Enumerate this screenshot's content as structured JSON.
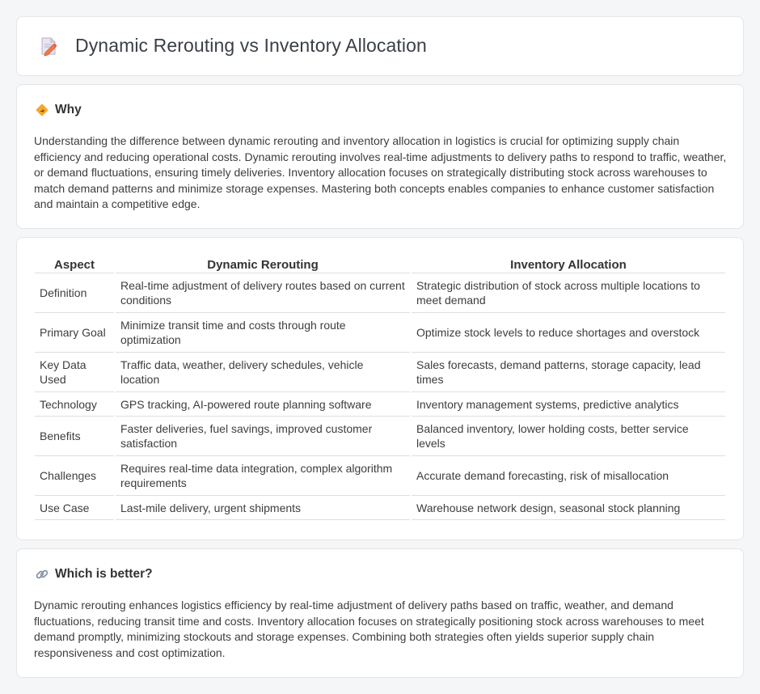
{
  "header": {
    "title": "Dynamic Rerouting vs Inventory Allocation",
    "icon": "document-pencil-icon"
  },
  "why": {
    "title": "Why",
    "icon": "diamond-road-sign-icon",
    "text": "Understanding the difference between dynamic rerouting and inventory allocation in logistics is crucial for optimizing supply chain efficiency and reducing operational costs. Dynamic rerouting involves real-time adjustments to delivery paths to respond to traffic, weather, or demand fluctuations, ensuring timely deliveries. Inventory allocation focuses on strategically distributing stock across warehouses to match demand patterns and minimize storage expenses. Mastering both concepts enables companies to enhance customer satisfaction and maintain a competitive edge."
  },
  "table": {
    "headers": [
      "Aspect",
      "Dynamic Rerouting",
      "Inventory Allocation"
    ],
    "rows": [
      {
        "aspect": "Definition",
        "dynamic": "Real-time adjustment of delivery routes based on current conditions",
        "inventory": "Strategic distribution of stock across multiple locations to meet demand"
      },
      {
        "aspect": "Primary Goal",
        "dynamic": "Minimize transit time and costs through route optimization",
        "inventory": "Optimize stock levels to reduce shortages and overstock"
      },
      {
        "aspect": "Key Data Used",
        "dynamic": "Traffic data, weather, delivery schedules, vehicle location",
        "inventory": "Sales forecasts, demand patterns, storage capacity, lead times"
      },
      {
        "aspect": "Technology",
        "dynamic": "GPS tracking, AI-powered route planning software",
        "inventory": "Inventory management systems, predictive analytics"
      },
      {
        "aspect": "Benefits",
        "dynamic": "Faster deliveries, fuel savings, improved customer satisfaction",
        "inventory": "Balanced inventory, lower holding costs, better service levels"
      },
      {
        "aspect": "Challenges",
        "dynamic": "Requires real-time data integration, complex algorithm requirements",
        "inventory": "Accurate demand forecasting, risk of misallocation"
      },
      {
        "aspect": "Use Case",
        "dynamic": "Last-mile delivery, urgent shipments",
        "inventory": "Warehouse network design, seasonal stock planning"
      }
    ]
  },
  "better": {
    "title": "Which is better?",
    "icon": "link-chain-icon",
    "text": "Dynamic rerouting enhances logistics efficiency by real-time adjustment of delivery paths based on traffic, weather, and demand fluctuations, reducing transit time and costs. Inventory allocation focuses on strategically positioning stock across warehouses to meet demand promptly, minimizing stockouts and storage expenses. Combining both strategies often yields superior supply chain responsiveness and cost optimization."
  }
}
